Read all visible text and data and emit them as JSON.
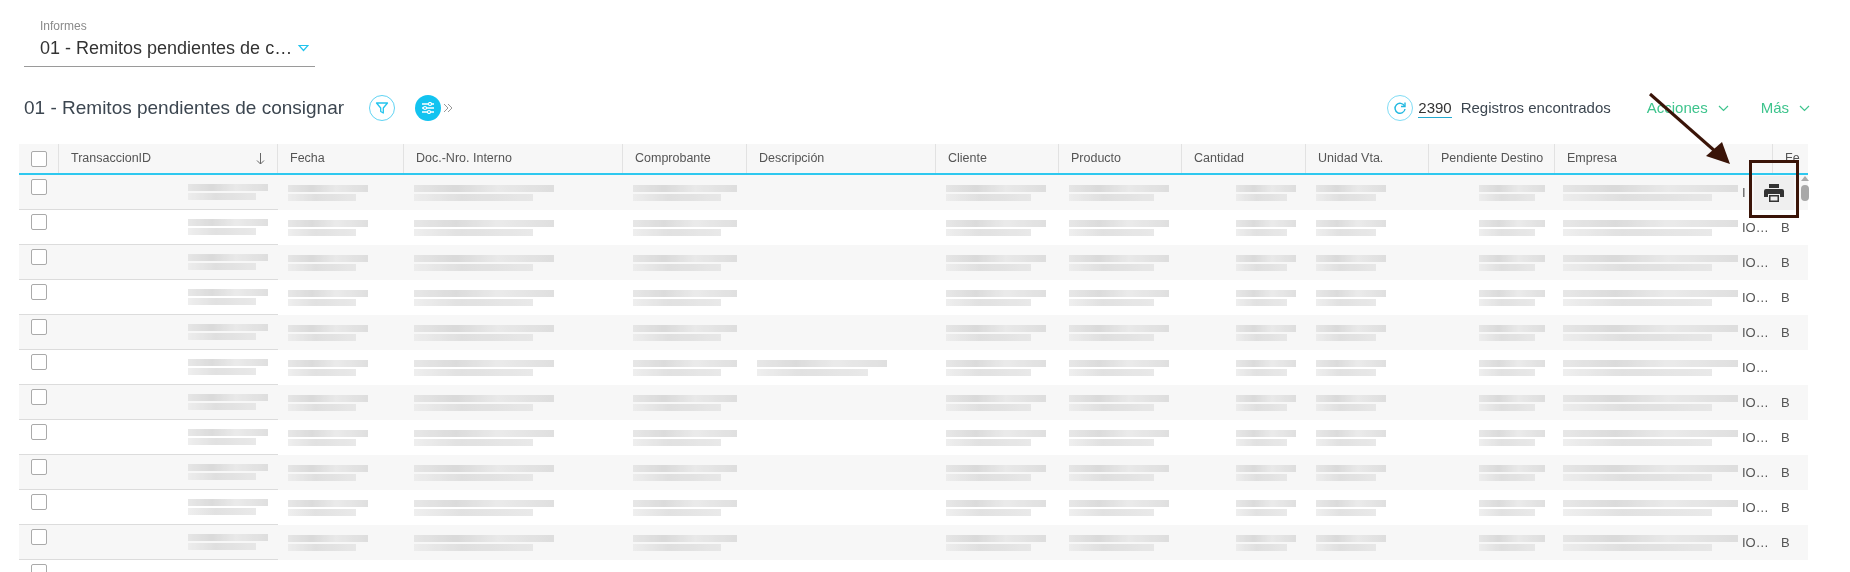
{
  "report_selector": {
    "label": "Informes",
    "value": "01 - Remitos pendientes de c…"
  },
  "title": "01 - Remitos pendientes de consignar",
  "record_count": "2390",
  "record_label": "Registros encontrados",
  "menus": [
    {
      "label": "Acciones"
    },
    {
      "label": "Más"
    }
  ],
  "table": {
    "select_all_checked": false,
    "columns": [
      {
        "label": "TransaccionID",
        "sorted": true
      },
      {
        "label": "Fecha"
      },
      {
        "label": "Doc.-Nro. Interno"
      },
      {
        "label": "Comprobante"
      },
      {
        "label": "Descripción"
      },
      {
        "label": "Cliente"
      },
      {
        "label": "Producto"
      },
      {
        "label": "Cantidad"
      },
      {
        "label": "Unidad Vta."
      },
      {
        "label": "Pendiente Destino"
      },
      {
        "label": "Empresa"
      },
      {
        "label": "Fe"
      }
    ],
    "rows": [
      {
        "checked": false,
        "empresa_tail": "I"
      },
      {
        "checked": false,
        "empresa_tail": "IO…",
        "column_12": "B"
      },
      {
        "checked": false,
        "empresa_tail": "IO…",
        "column_12": "B"
      },
      {
        "checked": false,
        "empresa_tail": "IO…",
        "column_12": "B"
      },
      {
        "checked": false,
        "empresa_tail": "IO…",
        "column_12": "B"
      },
      {
        "checked": false,
        "description_blurred": true,
        "empresa_tail": "IO…"
      },
      {
        "checked": false,
        "empresa_tail": "IO…",
        "column_12": "B"
      },
      {
        "checked": false,
        "empresa_tail": "IO…",
        "column_12": "B"
      },
      {
        "checked": false,
        "empresa_tail": "IO…",
        "column_12": "B"
      },
      {
        "checked": false,
        "empresa_tail": "IO…",
        "column_12": "B"
      },
      {
        "checked": false,
        "empresa_tail": "IO…",
        "column_12": "B"
      }
    ],
    "partial_row_checked": false
  }
}
